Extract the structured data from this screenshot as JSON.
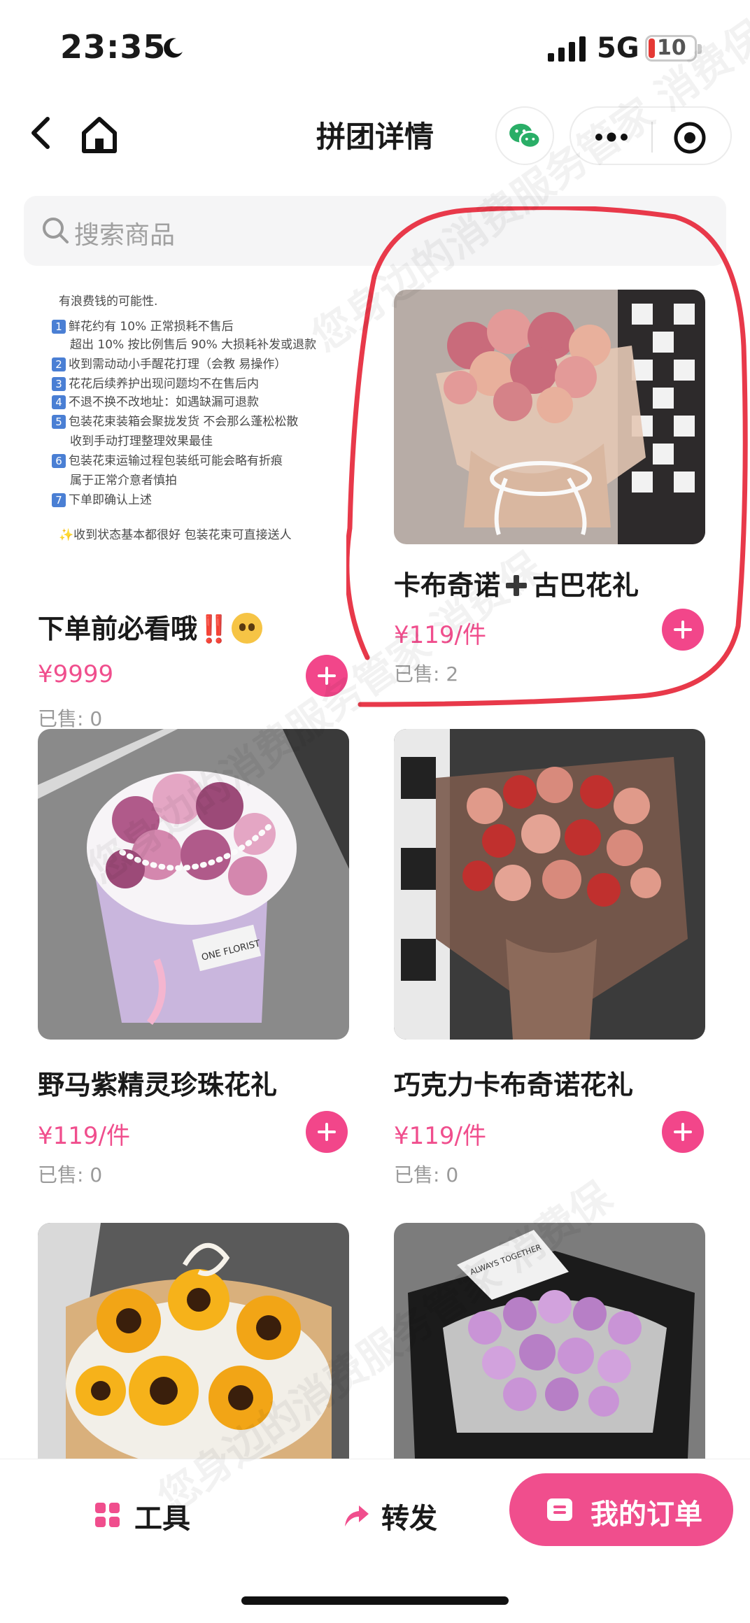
{
  "status_bar": {
    "time": "23:35",
    "network": "5G",
    "battery": "10"
  },
  "nav": {
    "title": "拼团详情"
  },
  "search": {
    "placeholder": "搜索商品"
  },
  "notice": {
    "intro": "有浪费钱的可能性.",
    "lines": [
      {
        "num": "1",
        "text": "鲜花约有 10% 正常损耗不售后"
      },
      {
        "num": "",
        "text": "超出 10% 按比例售后 90% 大损耗补发或退款"
      },
      {
        "num": "2",
        "text": "收到需动动小手醒花打理（会教 易操作）"
      },
      {
        "num": "3",
        "text": "花花后续养护出现问题均不在售后内"
      },
      {
        "num": "4",
        "text": "不退不换不改地址：如遇缺漏可退款"
      },
      {
        "num": "5",
        "text": "包装花束装箱会聚拢发货 不会那么蓬松松散"
      },
      {
        "num": "",
        "text": "收到手动打理整理效果最佳"
      },
      {
        "num": "6",
        "text": "包装花束运输过程包装纸可能会略有折痕"
      },
      {
        "num": "",
        "text": "属于正常介意者慎拍"
      },
      {
        "num": "7",
        "text": "下单即确认上述"
      }
    ],
    "footer": "✨收到状态基本都很好 包装花束可直接送人"
  },
  "products": [
    {
      "name": "下单前必看哦",
      "name_mark": "‼️",
      "price": "¥9999",
      "unit": "",
      "sold": "已售: 0"
    },
    {
      "name_a": "卡布奇诺",
      "name_b": "古巴花礼",
      "price": "¥119",
      "unit": "/件",
      "sold": "已售: 2"
    },
    {
      "name": "野马紫精灵珍珠花礼",
      "price": "¥119",
      "unit": "/件",
      "sold": "已售: 0"
    },
    {
      "name": "巧克力卡布奇诺花礼",
      "price": "¥119",
      "unit": "/件",
      "sold": "已售: 0"
    }
  ],
  "bouquet_wrap_text": {
    "card3_label": "ONE FLORIST",
    "card6_label": "ALWAYS TOGETHER"
  },
  "watermark": "您身边的消费服务管家 消费保",
  "bottom_bar": {
    "tools": "工具",
    "share": "转发",
    "orders": "我的订单"
  },
  "colors": {
    "accent": "#f04e8d",
    "annotation": "#e8394a",
    "wechat": "#2aae67"
  }
}
